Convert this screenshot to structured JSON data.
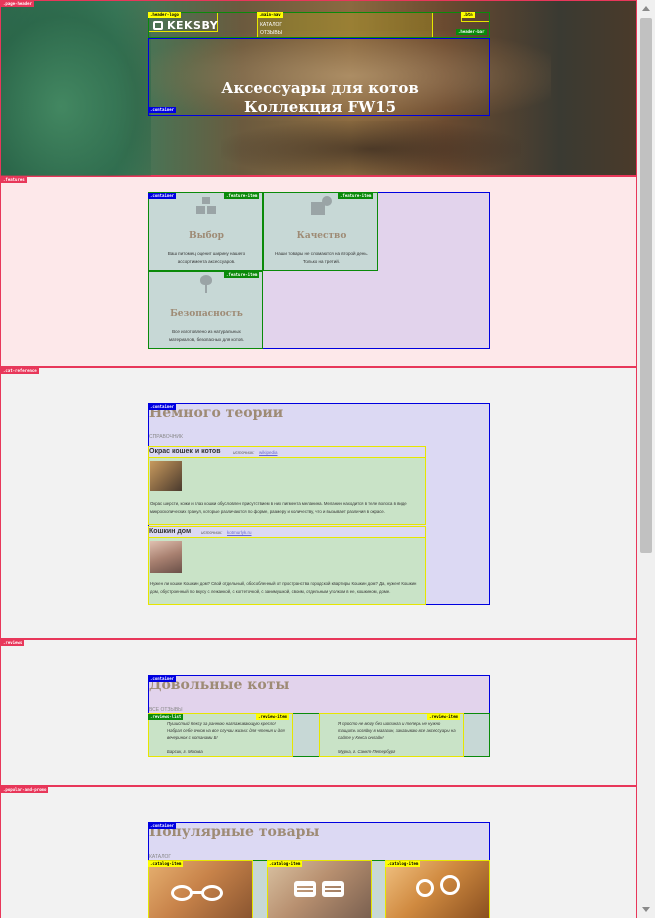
{
  "header": {
    "section_tag": ".page-header",
    "logo_tag": ".header-logo",
    "logo_text": "KEKSBY",
    "nav_tag": ".main-nav",
    "nav_items": [
      "КАТАЛОГ",
      "ОТЗЫВЫ"
    ],
    "btn_tag": ".btn",
    "bar_tag": ".header-bar",
    "container_tag": ".container",
    "title_line1": "Аксессуары для котов",
    "title_line2": "Коллекция FW15"
  },
  "features": {
    "section_tag": ".features",
    "container_tag": ".container",
    "item_tag": ".feature-item",
    "items": [
      {
        "title": "Выбор",
        "text": "Ваш питомец оценит ширину нашего ассортимента аксессуаров."
      },
      {
        "title": "Качество",
        "text": "Наши товары не сломаются на второй день. Только на третий."
      },
      {
        "title": "Безопасность",
        "text": "Все изготовлено из натуральных материалов, безопасных для котов."
      }
    ]
  },
  "theory": {
    "section_tag": ".cat-reference",
    "container_tag": ".container",
    "title": "Немного теории",
    "subtitle": "СПРАВОЧНИК",
    "articles": [
      {
        "title": "Окрас кошек и котов",
        "source_label": "источник:",
        "source_link": "wikipedia",
        "text": "Окрас шерсти, кожи и глаз кошки обусловлен присутствием в них пигмента меланина. Меланин находится в теле волоса в виде микроскопических гранул, которые различаются по форме, размеру и количеству, что и вызывает различия в окрасе."
      },
      {
        "title": "Кошкин дом",
        "source_label": "источник:",
        "source_link": "kotmurlyk.ru",
        "text": "Нужен ли кошке Кошкин дом? Свой отдельный, обособленный от пространства городской квартиры Кошкин дом? Да, нужен! Кошкин дом, обустроенный по вкусу с лежанкой, с когтеточкой, с занимушкой, своим, отдельным уголком в ее, кошкином, доме."
      }
    ]
  },
  "reviews": {
    "section_tag": ".reviews",
    "container_tag": ".container",
    "title": "Довольные коты",
    "subtitle": "ВСЕ ОТЗЫВЫ",
    "list_tag": ".reviews-list",
    "item_tag": ".review-item",
    "items": [
      {
        "text": "Пушистый Кексу за раннюю наглаживающую кресло! Набрал себе очков на все случаи жизни: для чтения и для вечеринок с котанами Б!",
        "author": "Барсик, г. Москва"
      },
      {
        "text": "Я просто не могу без шопинга и теперь не нужно тащить хозяйку в магазин, заказываю все аксессуары на сайте у Кекса онлайн!",
        "author": "Мурка, г. Санкт-Петербург"
      }
    ]
  },
  "popular": {
    "section_tag": ".popular-and-promo",
    "container_tag": ".container",
    "title": "Популярные товары",
    "subtitle": "КАТАЛОГ",
    "item_tag": ".catalog-item"
  }
}
